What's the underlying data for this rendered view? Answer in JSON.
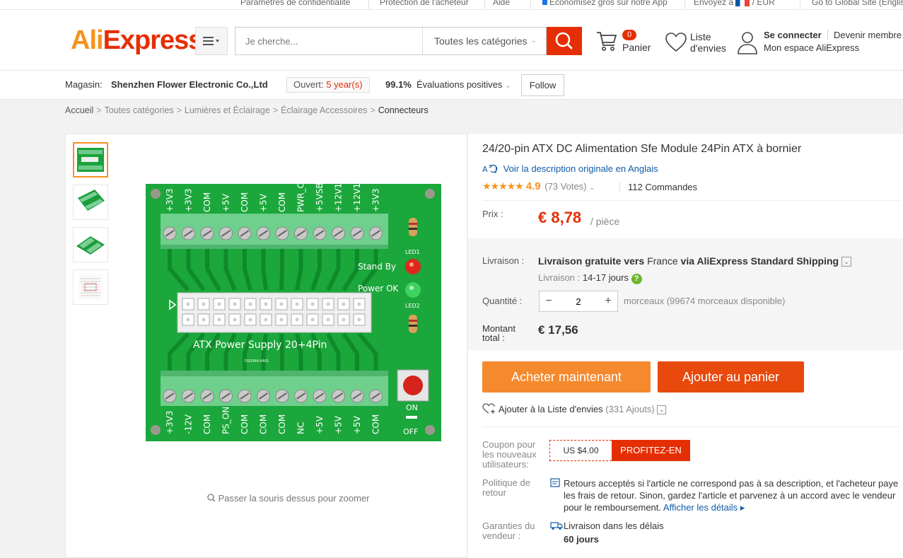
{
  "topbar": {
    "items": [
      "Paramètres de confidentialité",
      "Protection de l'acheteur",
      "Aide",
      "Économisez gros sur notre App",
      "Envoyez à",
      "/ EUR",
      "Go to Global Site (English)"
    ]
  },
  "header": {
    "logo_text_ali": "Ali",
    "logo_text_express": "Express",
    "logo_tm": "™",
    "search_placeholder": "Je cherche...",
    "category_select": "Toutes les catégories",
    "cart_count": "0",
    "cart_label": "Panier",
    "wishlist_label_1": "Liste",
    "wishlist_label_2": "d'envies",
    "signin": "Se connecter",
    "become_member": "Devenir membre",
    "my_account": "Mon espace AliExpress",
    "accent_color": "#e62e04"
  },
  "store": {
    "label": "Magasin:",
    "name": "Shenzhen Flower Electronic Co.,Ltd",
    "open_label": "Ouvert:",
    "open_value": "5 year(s)",
    "positive_pct": "99.1%",
    "positive_label": "Évaluations positives",
    "follow": "Follow"
  },
  "breadcrumb": [
    "Accueil",
    "Toutes catégories",
    "Lumières et Éclairage",
    "Éclairage Accessoires",
    "Connecteurs"
  ],
  "gallery": {
    "zoom_hint": "Passer la souris dessus pour zoomer",
    "board": {
      "top_labels": [
        "+3V3",
        "+3V3",
        "COM",
        "+5V",
        "COM",
        "+5V",
        "COM",
        "PWR_OK",
        "+5VSB",
        "+12V1",
        "+12V1",
        "+3V3"
      ],
      "bottom_labels": [
        "+3V3",
        "-12V",
        "COM",
        "PS_ON",
        "COM",
        "COM",
        "COM",
        "NC",
        "+5V",
        "+5V",
        "+5V",
        "COM"
      ],
      "standby": "Stand By",
      "power_ok": "Power OK",
      "led1": "LED1",
      "led2": "LED2",
      "atx_text": "ATX Power Supply 20+4Pin",
      "on": "ON",
      "off": "OFF",
      "part": "DS334A-V401"
    }
  },
  "product": {
    "title": "24/20-pin ATX DC Alimentation Sfe Module 24Pin ATX à bornier",
    "original_link": "Voir la description originale en Anglais",
    "rating": "4.9",
    "votes": "(73 Votes)",
    "orders": "112 Commandes",
    "stars": 5,
    "price_label": "Prix :",
    "price": "€ 8,78",
    "price_unit": "/ pièce",
    "shipping_label": "Livraison :",
    "shipping_main_bold": "Livraison gratuite vers",
    "shipping_country": "France",
    "shipping_via": "via AliExpress Standard Shipping",
    "shipping_time_label": "Livraison :",
    "shipping_time": "14-17 jours",
    "qty_label": "Quantité :",
    "qty": "2",
    "qty_available": "morceaux (99674 morceaux disponible)",
    "total_label_1": "Montant",
    "total_label_2": "total :",
    "total": "€ 17,56",
    "buy_now": "Acheter maintenant",
    "add_to_cart": "Ajouter au panier",
    "wishlist_add": "Ajouter à la Liste d'envies",
    "wishlist_count": "(331 Ajouts)",
    "coupon_label_1": "Coupon pour",
    "coupon_label_2": "les nouveaux",
    "coupon_label_3": "utilisateurs:",
    "coupon_value": "US $4.00",
    "coupon_action": "PROFITEZ-EN",
    "return_label_1": "Politique de",
    "return_label_2": "retour",
    "return_text": "Retours acceptés si l'article ne correspond pas à sa description, et l'acheteur paye les frais de retour. Sinon, gardez l'article et parvenez à un accord avec le vendeur pour le remboursement.",
    "return_link": "Afficher les détails",
    "guarantee_label_1": "Garanties du",
    "guarantee_label_2": "vendeur :",
    "guarantee_text": "Livraison dans les délais",
    "guarantee_days": "60 jours"
  }
}
